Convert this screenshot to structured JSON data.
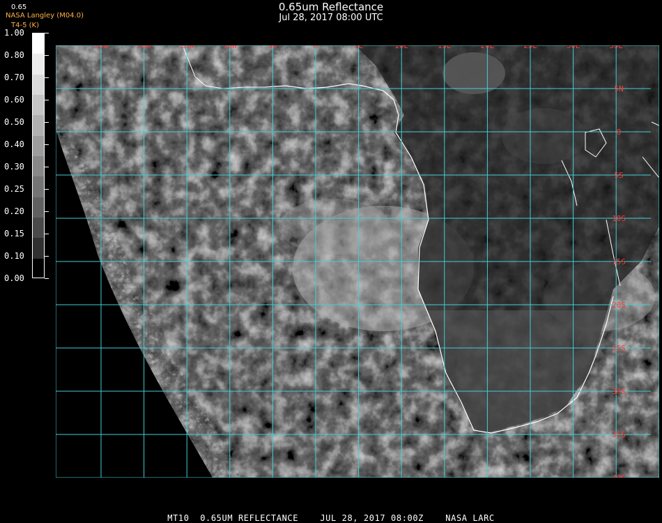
{
  "header": {
    "title": "0.65um Reflectance",
    "datetime": "Jul 28, 2017 08:00 UTC",
    "credit": "NASA Langley (M04.0)",
    "credit2": "T4-5 (K)",
    "colorbar_title": "0.65"
  },
  "colorbar": {
    "labels": [
      "1.00",
      "0.80",
      "0.70",
      "0.60",
      "0.50",
      "0.40",
      "0.30",
      "0.25",
      "0.20",
      "0.15",
      "0.10",
      "0.00"
    ],
    "colors": [
      "#ffffff",
      "#ececec",
      "#d9d9d9",
      "#c4c4c4",
      "#b0b0b0",
      "#9c9c9c",
      "#888888",
      "#747474",
      "#606060",
      "#4a4a4a",
      "#303030",
      "#000000"
    ]
  },
  "map": {
    "lon_labels": [
      "25W",
      "20W",
      "15W",
      "10W",
      "5W",
      "0",
      "5E",
      "10E",
      "15E",
      "20E",
      "25E",
      "30E",
      "35E"
    ],
    "lat_labels": [
      "5N",
      "0",
      "5S",
      "10S",
      "15S",
      "20S",
      "25S",
      "30S",
      "35S",
      "40S"
    ],
    "grid_color": "#3fd0d6",
    "label_color": "#ff3a3a",
    "coast_color": "#ffffff"
  },
  "footer": {
    "text": "MT10  0.65UM REFLECTANCE    JUL 28, 2017 08:00Z    NASA LARC"
  }
}
